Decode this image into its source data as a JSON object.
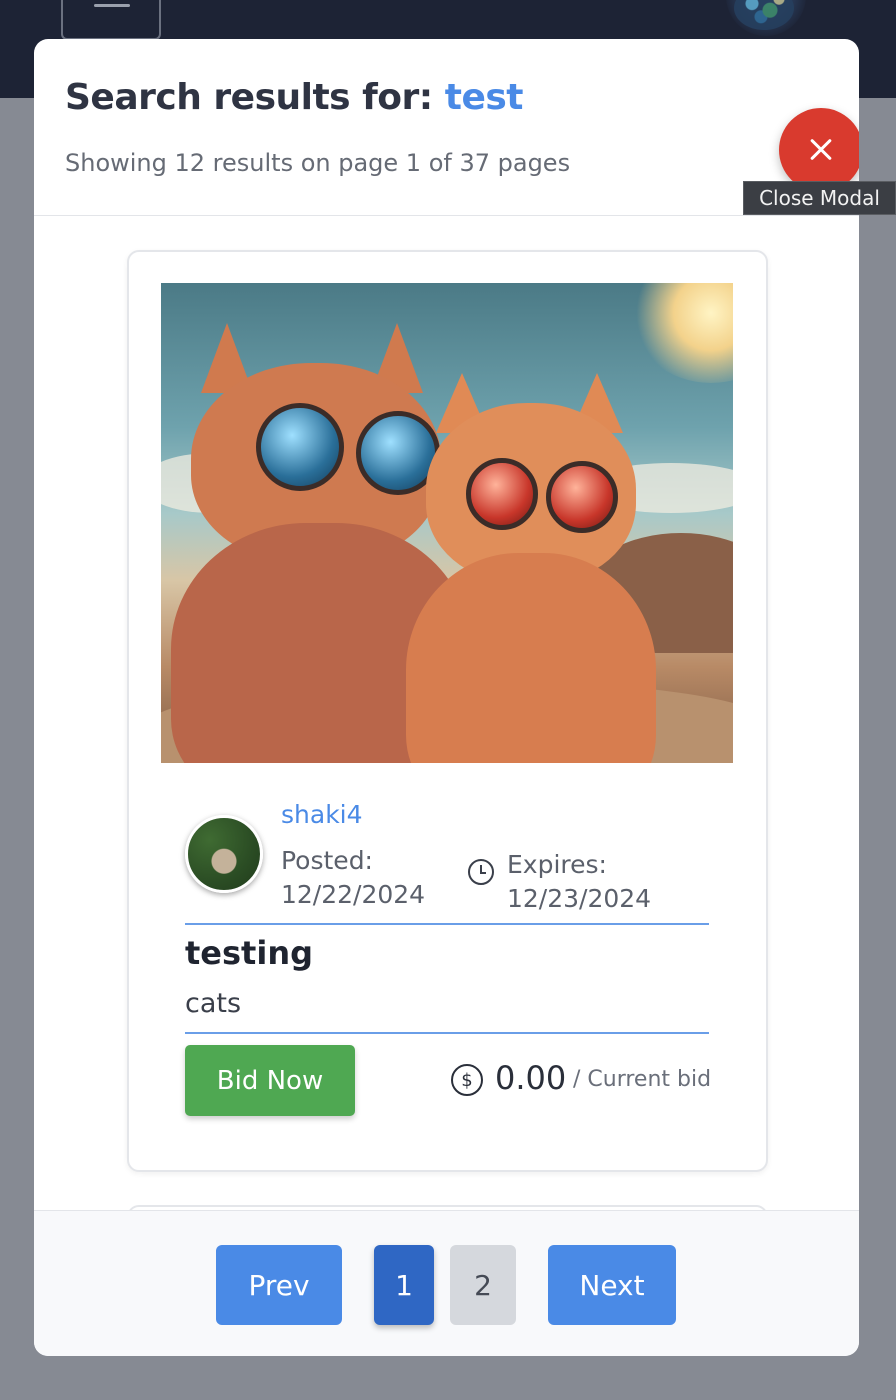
{
  "navbar": {
    "menu_icon": "hamburger-icon",
    "logo_icon": "globe-logo-icon"
  },
  "modal": {
    "title_prefix": "Search results for:",
    "query": "test",
    "summary": "Showing 12 results on page 1 of 37 pages",
    "close_icon": "close-icon",
    "close_tooltip": "Close Modal"
  },
  "results": [
    {
      "image_alt": "",
      "username": "shaki4",
      "posted_label": "Posted:",
      "posted_date": "12/22/2024",
      "expires_label": "Expires:",
      "expires_date": "12/23/2024",
      "title": "testing",
      "description": "cats",
      "bid_button": "Bid Now",
      "current_bid": "0.00",
      "current_bid_suffix": "/ Current bid"
    }
  ],
  "pagination": {
    "prev": "Prev",
    "pages": [
      "1",
      "2"
    ],
    "current_page": "1",
    "next": "Next"
  },
  "colors": {
    "accent": "#4a8ae6",
    "close": "#d93a2e",
    "bid": "#4fa852"
  }
}
